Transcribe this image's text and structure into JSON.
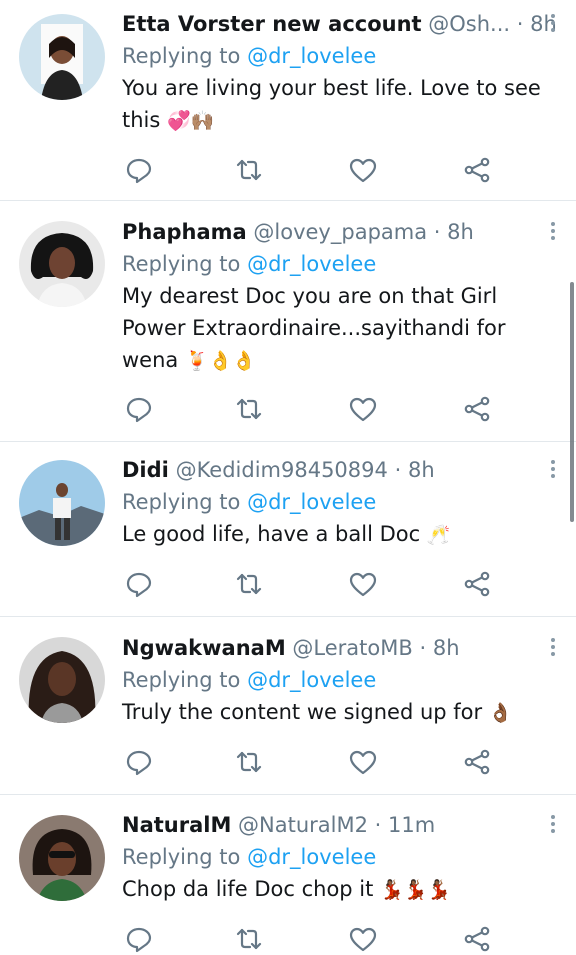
{
  "tweets": [
    {
      "name": "Etta Vorster new account",
      "handle": "@Osh...",
      "dot": "·",
      "time": "8h",
      "replying_prefix": "Replying to ",
      "replying_to": "@dr_lovelee",
      "text": "You are living your best life. Love to see this",
      "emoji": "💞🙌🏽"
    },
    {
      "name": "Phaphama",
      "handle": "@lovey_papama",
      "dot": "·",
      "time": "8h",
      "replying_prefix": "Replying to ",
      "replying_to": "@dr_lovelee",
      "text": "My dearest Doc you are on that Girl Power Extraordinaire...sayithandi for wena",
      "emoji": "🍹👌👌"
    },
    {
      "name": "Didi",
      "handle": "@Kedidim98450894",
      "dot": "·",
      "time": "8h",
      "replying_prefix": "Replying to ",
      "replying_to": "@dr_lovelee",
      "text": "Le good life, have a ball Doc",
      "emoji": "🥂"
    },
    {
      "name": "NgwakwanaM",
      "handle": "@LeratoMB",
      "dot": "·",
      "time": "8h",
      "replying_prefix": "Replying to ",
      "replying_to": "@dr_lovelee",
      "text": "Truly the content we signed up for",
      "emoji": "👌🏾"
    },
    {
      "name": "NaturalM",
      "handle": "@NaturalM2",
      "dot": "·",
      "time": "11m",
      "replying_prefix": "Replying to ",
      "replying_to": "@dr_lovelee",
      "text": "Chop da life Doc chop it",
      "emoji": "💃🏾💃🏾💃🏾"
    }
  ],
  "colors": {
    "accent": "#1da1f2",
    "secondary_text": "#657786",
    "icon": "#657786",
    "divider": "#e3e8ec"
  },
  "icons": [
    "reply-icon",
    "retweet-icon",
    "like-icon",
    "share-icon",
    "more-icon"
  ]
}
